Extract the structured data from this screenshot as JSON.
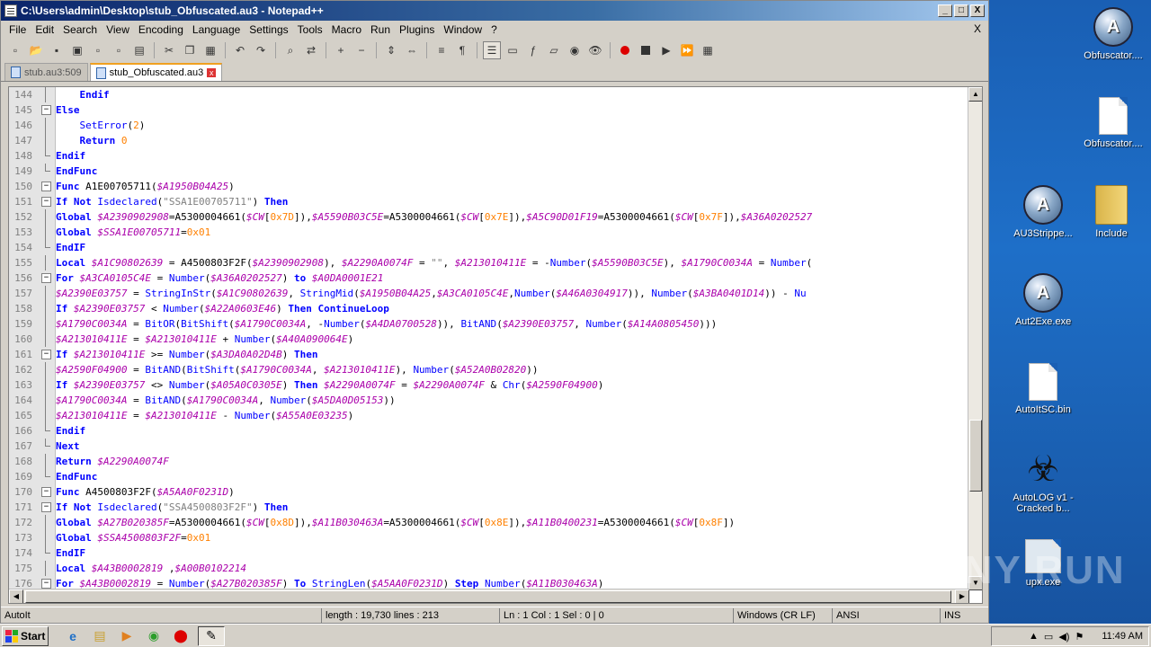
{
  "window": {
    "title": "C:\\Users\\admin\\Desktop\\stub_Obfuscated.au3 - Notepad++",
    "minimize": "_",
    "maximize": "□",
    "close": "X"
  },
  "menu": [
    "File",
    "Edit",
    "Search",
    "View",
    "Encoding",
    "Language",
    "Settings",
    "Tools",
    "Macro",
    "Run",
    "Plugins",
    "Window",
    "?"
  ],
  "menu_close": "X",
  "tabs": [
    {
      "label": "stub.au3:509",
      "active": false
    },
    {
      "label": "stub_Obfuscated.au3",
      "active": true
    }
  ],
  "tab_close": "x",
  "code_lines": [
    {
      "n": "144",
      "fold": "vline",
      "html": "    <span class='kw'>Endif</span>"
    },
    {
      "n": "145",
      "fold": "box",
      "html": "<span class='kw'>Else</span>"
    },
    {
      "n": "146",
      "fold": "vline",
      "html": "    <span class='bfn'>SetError</span>(<span class='num'>2</span>)"
    },
    {
      "n": "147",
      "fold": "vline",
      "html": "    <span class='kw'>Return</span> <span class='num'>0</span>"
    },
    {
      "n": "148",
      "fold": "end",
      "html": "<span class='kw'>Endif</span>"
    },
    {
      "n": "149",
      "fold": "end",
      "html": "<span class='kw'>EndFunc</span>"
    },
    {
      "n": "150",
      "fold": "box",
      "html": "<span class='kw'>Func</span> A1E00705711(<span class='var'>$A1950B04A25</span>)"
    },
    {
      "n": "151",
      "fold": "box",
      "html": "<span class='kw'>If Not</span> <span class='bfn'>Isdeclared</span>(<span class='str'>\"SSA1E00705711\"</span>) <span class='kw'>Then</span>"
    },
    {
      "n": "152",
      "fold": "vline",
      "html": "<span class='kw'>Global</span> <span class='var'>$A2390902908</span>=A5300004661(<span class='var'>$CW</span>[<span class='num'>0x7D</span>]),<span class='var'>$A5590B03C5E</span>=A5300004661(<span class='var'>$CW</span>[<span class='num'>0x7E</span>]),<span class='var'>$A5C90D01F19</span>=A5300004661(<span class='var'>$CW</span>[<span class='num'>0x7F</span>]),<span class='var'>$A36A0202527</span>"
    },
    {
      "n": "153",
      "fold": "vline",
      "html": "<span class='kw'>Global</span> <span class='var'>$SSA1E00705711</span>=<span class='num'>0x01</span>"
    },
    {
      "n": "154",
      "fold": "end",
      "html": "<span class='kw'>EndIF</span>"
    },
    {
      "n": "155",
      "fold": "vline",
      "html": "<span class='kw'>Local</span> <span class='var'>$A1C90802639</span> = A4500803F2F(<span class='var'>$A2390902908</span>), <span class='var'>$A2290A0074F</span> = <span class='str'>\"\"</span>, <span class='var'>$A213010411E</span> = -<span class='bfn'>Number</span>(<span class='var'>$A5590B03C5E</span>), <span class='var'>$A1790C0034A</span> = <span class='bfn'>Number</span>("
    },
    {
      "n": "156",
      "fold": "box",
      "html": "<span class='kw'>For</span> <span class='var'>$A3CA0105C4E</span> = <span class='bfn'>Number</span>(<span class='var'>$A36A0202527</span>) <span class='kw'>to</span> <span class='var'>$A0DA0001E21</span>"
    },
    {
      "n": "157",
      "fold": "vline",
      "html": "<span class='var'>$A2390E03757</span> = <span class='bfn'>StringInStr</span>(<span class='var'>$A1C90802639</span>, <span class='bfn'>StringMid</span>(<span class='var'>$A1950B04A25</span>,<span class='var'>$A3CA0105C4E</span>,<span class='bfn'>Number</span>(<span class='var'>$A46A0304917</span>)), <span class='bfn'>Number</span>(<span class='var'>$A3BA0401D14</span>)) - <span class='bfn'>Nu</span>"
    },
    {
      "n": "158",
      "fold": "vline",
      "html": "<span class='kw'>If</span> <span class='var'>$A2390E03757</span> &lt; <span class='bfn'>Number</span>(<span class='var'>$A22A0603E46</span>) <span class='kw'>Then ContinueLoop</span>"
    },
    {
      "n": "159",
      "fold": "vline",
      "html": "<span class='var'>$A1790C0034A</span> = <span class='bfn'>BitOR</span>(<span class='bfn'>BitShift</span>(<span class='var'>$A1790C0034A</span>, -<span class='bfn'>Number</span>(<span class='var'>$A4DA0700528</span>)), <span class='bfn'>BitAND</span>(<span class='var'>$A2390E03757</span>, <span class='bfn'>Number</span>(<span class='var'>$A14A0805450</span>)))"
    },
    {
      "n": "160",
      "fold": "vline",
      "html": "<span class='var'>$A213010411E</span> = <span class='var'>$A213010411E</span> + <span class='bfn'>Number</span>(<span class='var'>$A40A090064E</span>)"
    },
    {
      "n": "161",
      "fold": "box",
      "html": "<span class='kw'>If</span> <span class='var'>$A213010411E</span> &gt;= <span class='bfn'>Number</span>(<span class='var'>$A3DA0A02D4B</span>) <span class='kw'>Then</span>"
    },
    {
      "n": "162",
      "fold": "vline",
      "html": "<span class='var'>$A2590F04900</span> = <span class='bfn'>BitAND</span>(<span class='bfn'>BitShift</span>(<span class='var'>$A1790C0034A</span>, <span class='var'>$A213010411E</span>), <span class='bfn'>Number</span>(<span class='var'>$A52A0B02820</span>))"
    },
    {
      "n": "163",
      "fold": "vline",
      "html": "<span class='kw'>If</span> <span class='var'>$A2390E03757</span> &lt;&gt; <span class='bfn'>Number</span>(<span class='var'>$A05A0C0305E</span>) <span class='kw'>Then</span> <span class='var'>$A2290A0074F</span> = <span class='var'>$A2290A0074F</span> &amp; <span class='bfn'>Chr</span>(<span class='var'>$A2590F04900</span>)"
    },
    {
      "n": "164",
      "fold": "vline",
      "html": "<span class='var'>$A1790C0034A</span> = <span class='bfn'>BitAND</span>(<span class='var'>$A1790C0034A</span>, <span class='bfn'>Number</span>(<span class='var'>$A5DA0D05153</span>))"
    },
    {
      "n": "165",
      "fold": "vline",
      "html": "<span class='var'>$A213010411E</span> = <span class='var'>$A213010411E</span> - <span class='bfn'>Number</span>(<span class='var'>$A55A0E03235</span>)"
    },
    {
      "n": "166",
      "fold": "end",
      "html": "<span class='kw'>Endif</span>"
    },
    {
      "n": "167",
      "fold": "end",
      "html": "<span class='kw'>Next</span>"
    },
    {
      "n": "168",
      "fold": "vline",
      "html": "<span class='kw'>Return</span> <span class='var'>$A2290A0074F</span>"
    },
    {
      "n": "169",
      "fold": "end",
      "html": "<span class='kw'>EndFunc</span>"
    },
    {
      "n": "170",
      "fold": "box",
      "html": "<span class='kw'>Func</span> A4500803F2F(<span class='var'>$A5AA0F0231D</span>)"
    },
    {
      "n": "171",
      "fold": "box",
      "html": "<span class='kw'>If Not</span> <span class='bfn'>Isdeclared</span>(<span class='str'>\"SSA4500803F2F\"</span>) <span class='kw'>Then</span>"
    },
    {
      "n": "172",
      "fold": "vline",
      "html": "<span class='kw'>Global</span> <span class='var'>$A27B020385F</span>=A5300004661(<span class='var'>$CW</span>[<span class='num'>0x8D</span>]),<span class='var'>$A11B030463A</span>=A5300004661(<span class='var'>$CW</span>[<span class='num'>0x8E</span>]),<span class='var'>$A11B0400231</span>=A5300004661(<span class='var'>$CW</span>[<span class='num'>0x8F</span>])"
    },
    {
      "n": "173",
      "fold": "vline",
      "html": "<span class='kw'>Global</span> <span class='var'>$SSA4500803F2F</span>=<span class='num'>0x01</span>"
    },
    {
      "n": "174",
      "fold": "end",
      "html": "<span class='kw'>EndIF</span>"
    },
    {
      "n": "175",
      "fold": "vline",
      "html": "<span class='kw'>Local</span> <span class='var'>$A43B0002819</span> ,<span class='var'>$A00B0102214</span>"
    },
    {
      "n": "176",
      "fold": "box",
      "html": "<span class='kw'>For</span> <span class='var'>$A43B0002819</span> = <span class='bfn'>Number</span>(<span class='var'>$A27B020385F</span>) <span class='kw'>To</span> <span class='bfn'>StringLen</span>(<span class='var'>$A5AA0F0231D</span>) <span class='kw'>Step</span> <span class='bfn'>Number</span>(<span class='var'>$A11B030463A</span>)"
    }
  ],
  "status": {
    "language": "AutoIt",
    "length": "length : 19,730    lines : 213",
    "position": "Ln : 1    Col : 1    Sel : 0 | 0",
    "eol": "Windows (CR LF)",
    "encoding": "ANSI",
    "mode": "INS"
  },
  "desktop_icons": [
    {
      "label": "Obfuscator....",
      "kind": "autoit"
    },
    {
      "label": "Obfuscator....",
      "kind": "doc"
    },
    {
      "label": "AU3Strippe...",
      "kind": "autoit"
    },
    {
      "label": "Include",
      "kind": "folder"
    },
    {
      "label": "Aut2Exe.exe",
      "kind": "circle"
    },
    {
      "label": "AutoItSC.bin",
      "kind": "doc"
    },
    {
      "label": "AutoLOG v1 - Cracked b...",
      "kind": "bio"
    },
    {
      "label": "upx.exe",
      "kind": "window"
    }
  ],
  "taskbar": {
    "start_label": "Start",
    "clock": "11:49 AM"
  },
  "watermark": "ANY RUN"
}
